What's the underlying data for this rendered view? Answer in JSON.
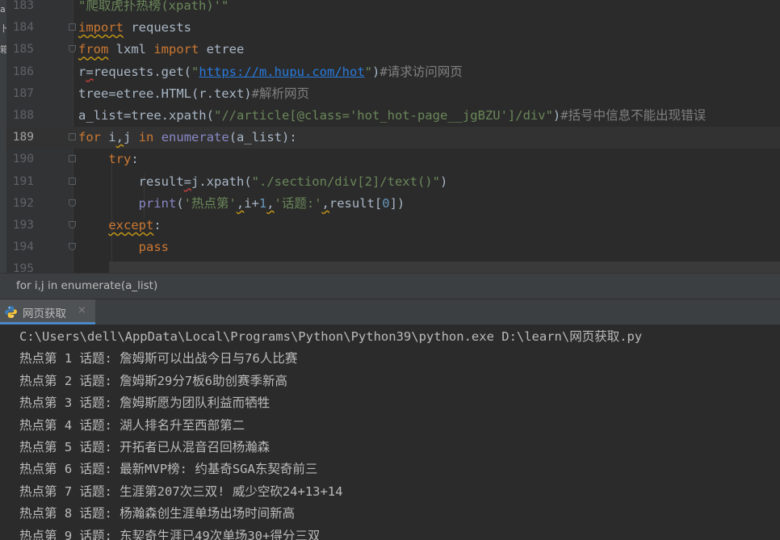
{
  "edge_glyphs": [
    "a",
    "卜",
    "箱"
  ],
  "editor": {
    "current_line": "189",
    "lines": [
      {
        "no": "183",
        "segments": [
          {
            "cls": "str",
            "text": "\"爬取虎扑热榜(xpath)'\""
          }
        ]
      },
      {
        "no": "184",
        "segments": [
          {
            "cls": "kw squig-y",
            "text": "import"
          },
          {
            "cls": "pl",
            "text": " requests"
          }
        ]
      },
      {
        "no": "185",
        "segments": [
          {
            "cls": "kw squig-y",
            "text": "from"
          },
          {
            "cls": "pl",
            "text": " lxml "
          },
          {
            "cls": "kw",
            "text": "import"
          },
          {
            "cls": "pl",
            "text": " etree"
          }
        ]
      },
      {
        "no": "186",
        "segments": [
          {
            "cls": "pl",
            "text": "r"
          },
          {
            "cls": "pl squig",
            "text": "="
          },
          {
            "cls": "pl",
            "text": "requests.get("
          },
          {
            "cls": "str",
            "text": "\""
          },
          {
            "cls": "url",
            "text": "https://m.hupu.com/hot"
          },
          {
            "cls": "str",
            "text": "\""
          },
          {
            "cls": "pl",
            "text": ")"
          },
          {
            "cls": "cmt",
            "text": "#请求访问网页"
          }
        ]
      },
      {
        "no": "187",
        "segments": [
          {
            "cls": "pl",
            "text": "tree=etree.HTML(r.text)"
          },
          {
            "cls": "cmt",
            "text": "#解析网页"
          }
        ]
      },
      {
        "no": "188",
        "segments": [
          {
            "cls": "pl",
            "text": "a_list=tree.xpath("
          },
          {
            "cls": "str",
            "text": "\"//article[@class='hot_hot-page__jgBZU']/div\""
          },
          {
            "cls": "pl",
            "text": ")"
          },
          {
            "cls": "cmt",
            "text": "#括号中信息不能出现错误"
          }
        ]
      },
      {
        "no": "189",
        "segments": [
          {
            "cls": "kw",
            "text": "for"
          },
          {
            "cls": "pl",
            "text": " i"
          },
          {
            "cls": "pl squig-y",
            "text": ","
          },
          {
            "cls": "pl",
            "text": "j "
          },
          {
            "cls": "kw",
            "text": "in"
          },
          {
            "cls": "pl",
            "text": " "
          },
          {
            "cls": "bi",
            "text": "enumerate"
          },
          {
            "cls": "pl",
            "text": "(a_list):"
          }
        ]
      },
      {
        "no": "190",
        "segments": [
          {
            "cls": "pl",
            "text": "    "
          },
          {
            "cls": "kw",
            "text": "try"
          },
          {
            "cls": "pl",
            "text": ":"
          }
        ]
      },
      {
        "no": "191",
        "segments": [
          {
            "cls": "pl",
            "text": "        result"
          },
          {
            "cls": "pl squig",
            "text": "="
          },
          {
            "cls": "pl",
            "text": "j.xpath("
          },
          {
            "cls": "str",
            "text": "\"./section/div[2]/text()\""
          },
          {
            "cls": "pl",
            "text": ")"
          }
        ]
      },
      {
        "no": "192",
        "segments": [
          {
            "cls": "pl",
            "text": "        "
          },
          {
            "cls": "bi",
            "text": "print"
          },
          {
            "cls": "pl",
            "text": "("
          },
          {
            "cls": "str",
            "text": "'热点第'"
          },
          {
            "cls": "pl squig-y",
            "text": ","
          },
          {
            "cls": "pl",
            "text": "i+"
          },
          {
            "cls": "num",
            "text": "1"
          },
          {
            "cls": "pl squig-y",
            "text": ","
          },
          {
            "cls": "str",
            "text": "'话题:'"
          },
          {
            "cls": "pl squig-y",
            "text": ","
          },
          {
            "cls": "pl",
            "text": "result["
          },
          {
            "cls": "num",
            "text": "0"
          },
          {
            "cls": "pl",
            "text": "])"
          }
        ]
      },
      {
        "no": "193",
        "segments": [
          {
            "cls": "pl",
            "text": "    "
          },
          {
            "cls": "kw squig-y",
            "text": "except"
          },
          {
            "cls": "pl",
            "text": ":"
          }
        ]
      },
      {
        "no": "194",
        "segments": [
          {
            "cls": "pl",
            "text": "        "
          },
          {
            "cls": "kw",
            "text": "pass"
          }
        ]
      },
      {
        "no": "195",
        "segments": []
      }
    ]
  },
  "breadcrumb": "for i,j in enumerate(a_list)",
  "run_tab": {
    "label": "网页获取",
    "close": "×",
    "icon": "python-icon"
  },
  "console": {
    "lines": [
      "C:\\Users\\dell\\AppData\\Local\\Programs\\Python\\Python39\\python.exe D:\\learn\\网页获取.py",
      "热点第 1 话题: 詹姆斯可以出战今日与76人比赛",
      "热点第 2 话题: 詹姆斯29分7板6助创赛季新高",
      "热点第 3 话题: 詹姆斯愿为团队利益而牺牲",
      "热点第 4 话题: 湖人排名升至西部第二",
      "热点第 5 话题: 开拓者已从混音召回杨瀚森",
      "热点第 6 话题: 最新MVP榜: 约基奇SGA东契奇前三",
      "热点第 7 话题: 生涯第207次三双! 威少空砍24+13+14",
      "热点第 8 话题: 杨瀚森创生涯单场出场时间新高",
      "热点第 9 话题: 东契奇生涯已49次单场30+得分三双"
    ]
  },
  "colors": {
    "keyword": "#cc7832",
    "string": "#6a8759",
    "comment": "#808080",
    "builtin": "#8888c6",
    "number": "#6897bb",
    "link": "#287bde",
    "tab_accent": "#4a88c7"
  }
}
